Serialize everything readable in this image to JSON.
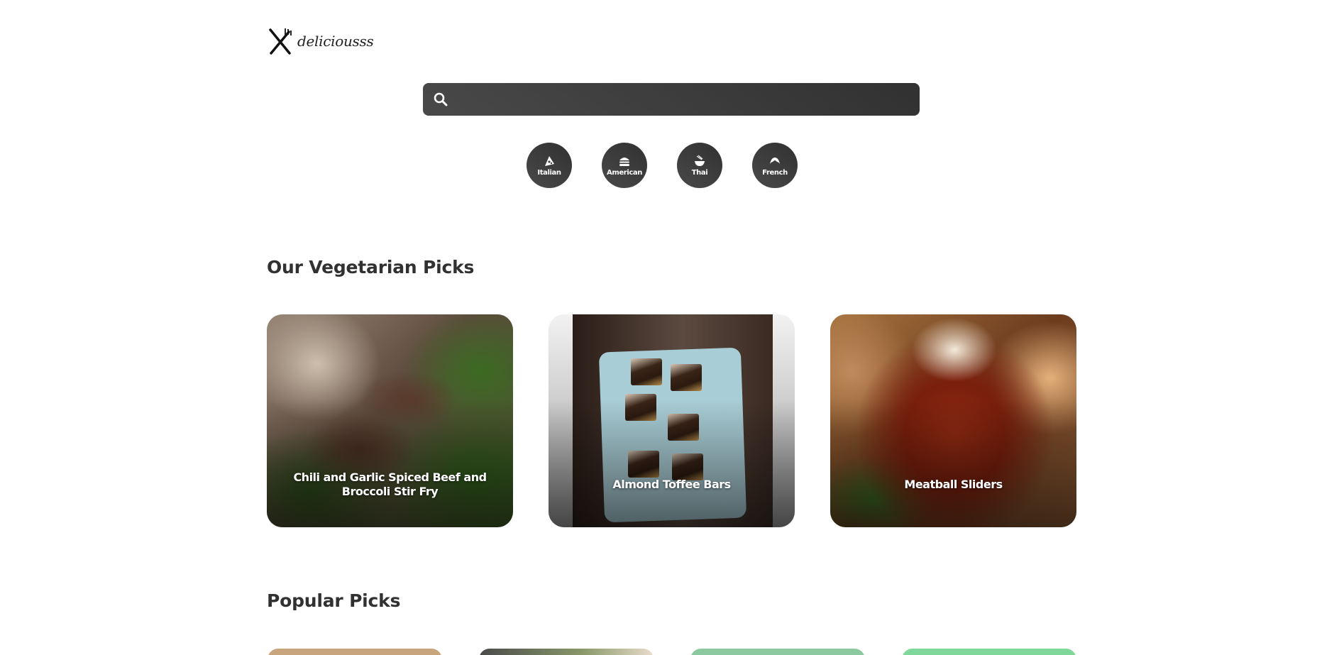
{
  "app": {
    "logo_text": "deliciousss"
  },
  "search": {
    "value": "",
    "placeholder": ""
  },
  "cuisines": [
    {
      "label": "Italian",
      "icon": "pizza-icon"
    },
    {
      "label": "American",
      "icon": "hamburger-icon"
    },
    {
      "label": "Thai",
      "icon": "noodle-bowl-icon"
    },
    {
      "label": "French",
      "icon": "croissant-icon"
    }
  ],
  "vegetarian": {
    "title": "Our Vegetarian Picks",
    "recipes": [
      {
        "title": "Chili and Garlic Spiced Beef and Broccoli Stir Fry"
      },
      {
        "title": "Almond Toffee Bars"
      },
      {
        "title": "Meatball Sliders"
      }
    ]
  },
  "popular": {
    "title": "Popular Picks"
  },
  "colors": {
    "dark_gradient_start": "#494949",
    "dark_gradient_end": "#313131",
    "text": "#313131",
    "background": "#ffffff"
  }
}
